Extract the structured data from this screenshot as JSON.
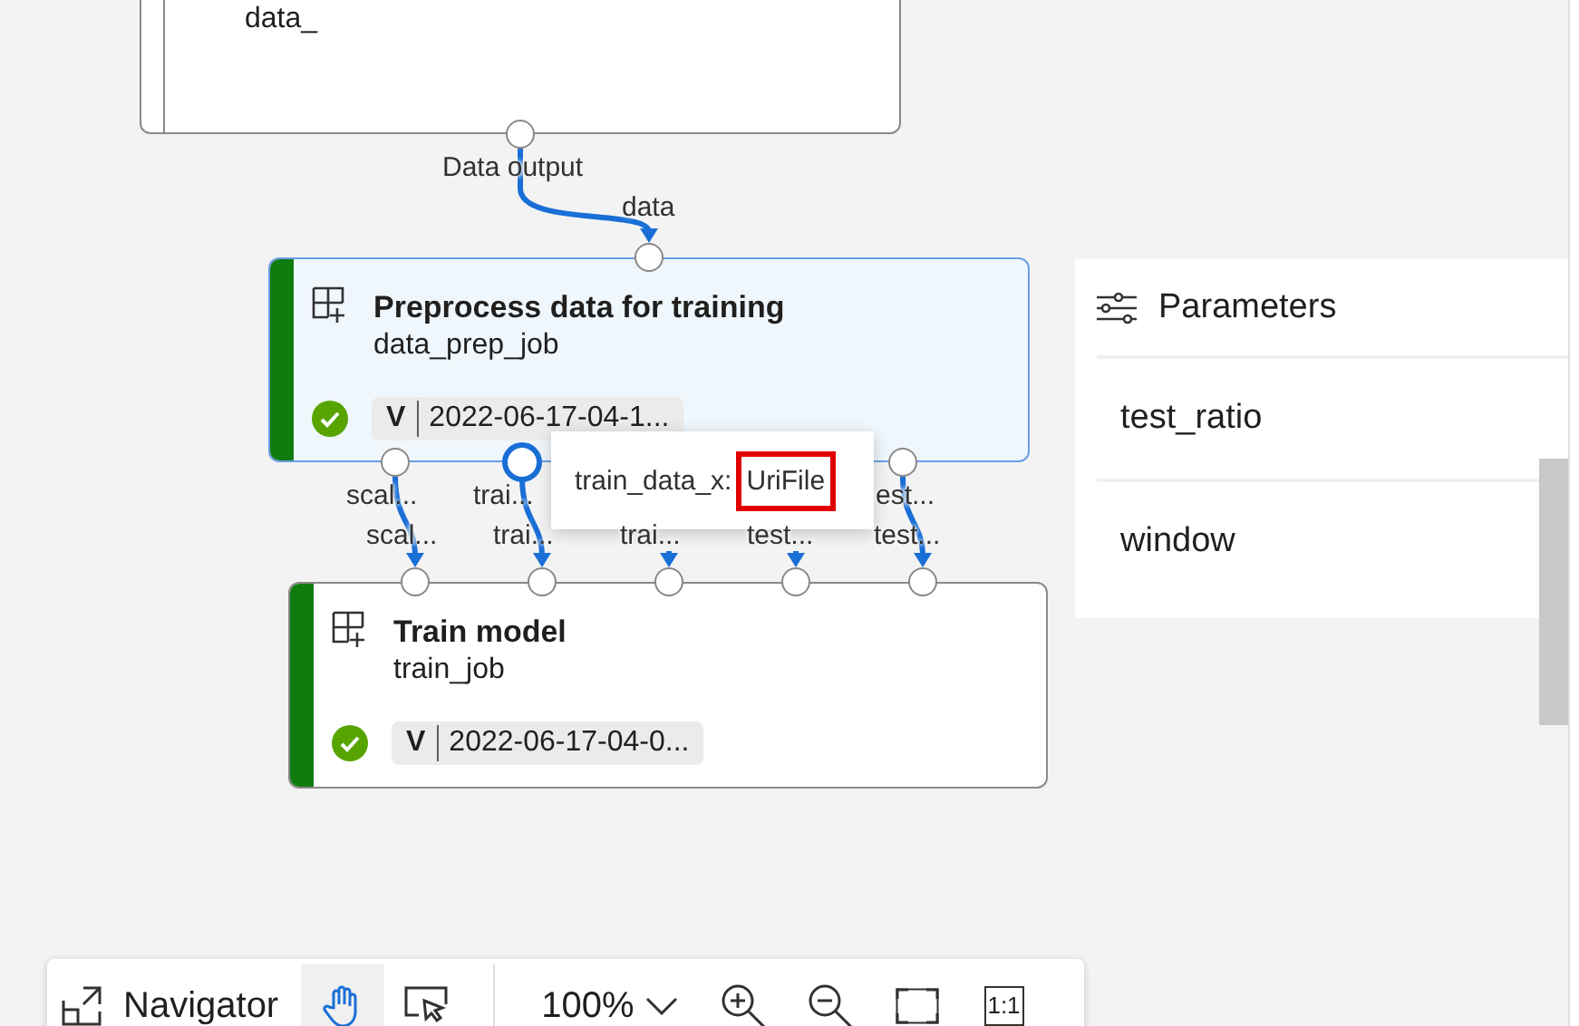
{
  "top_node": {
    "subtitle": "data_",
    "output_label": "Data output"
  },
  "jobs": [
    {
      "title": "Preprocess data for training",
      "subtitle": "data_prep_job",
      "selected": true,
      "succeeded": true,
      "version_badge": "V",
      "version": "2022-06-17-04-1...",
      "input_ports": [
        {
          "label": "data",
          "selected": false
        }
      ],
      "output_ports": [
        {
          "label": "scal...",
          "selected": false
        },
        {
          "label": "trai...",
          "selected": true
        },
        {
          "label": "est...",
          "selected": false
        }
      ]
    },
    {
      "title": "Train model",
      "subtitle": "train_job",
      "selected": false,
      "succeeded": true,
      "version_badge": "V",
      "version": "2022-06-17-04-0...",
      "input_ports": [
        {
          "label": "scal...",
          "selected": false
        },
        {
          "label": "trai...",
          "selected": false
        },
        {
          "label": "trai...",
          "selected": false
        },
        {
          "label": "test...",
          "selected": false
        },
        {
          "label": "test...",
          "selected": false
        }
      ]
    }
  ],
  "tooltip": {
    "name": "train_data_x:",
    "type": "UriFile",
    "highlighted": true
  },
  "parameters": {
    "title": "Parameters",
    "items": [
      "test_ratio",
      "window"
    ]
  },
  "toolbar": {
    "title": "Navigator",
    "tools": [
      {
        "kind": "pan",
        "selected": true
      },
      {
        "kind": "select",
        "selected": false
      }
    ],
    "zoom": "100%",
    "buttons": [
      {
        "kind": "zoom-in"
      },
      {
        "kind": "zoom-out"
      },
      {
        "kind": "fit"
      },
      {
        "kind": "actual-size",
        "label": "1:1"
      }
    ]
  }
}
